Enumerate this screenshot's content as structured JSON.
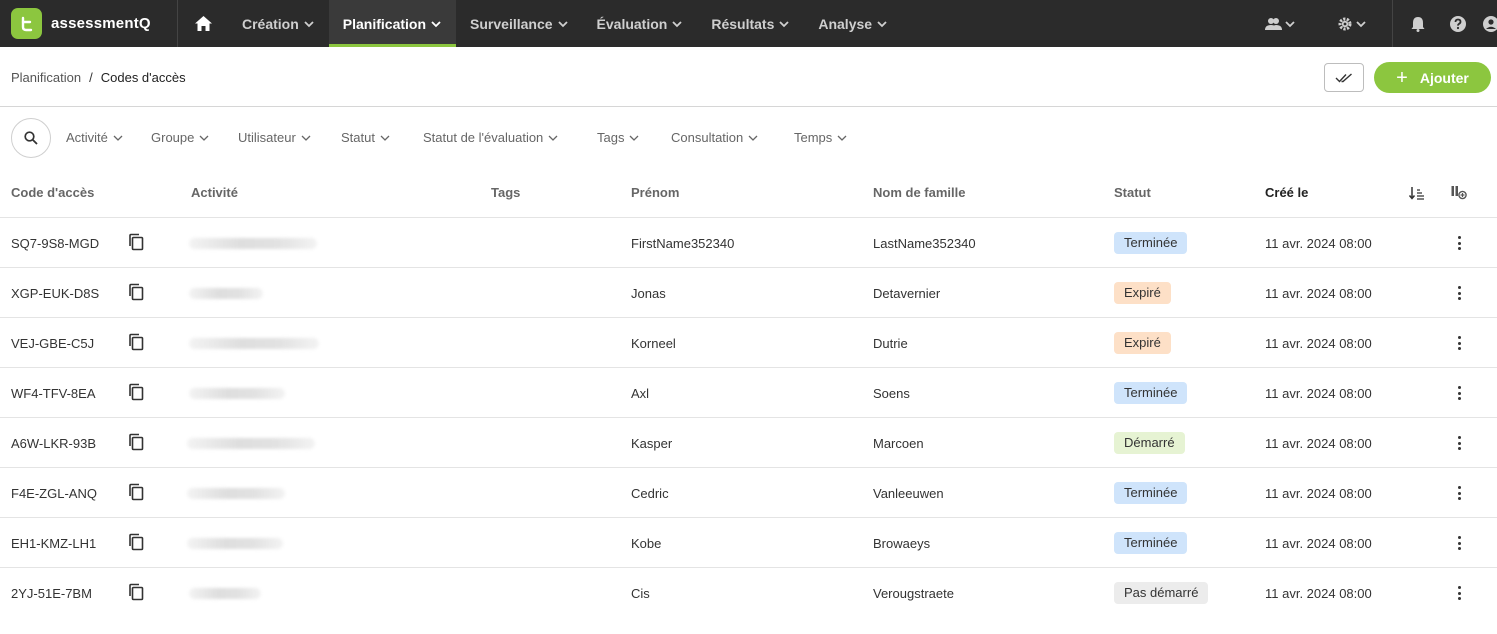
{
  "app": {
    "name": "assessmentQ",
    "logo_letter": "t"
  },
  "nav": {
    "items": [
      {
        "label": "Création",
        "active": false
      },
      {
        "label": "Planification",
        "active": true
      },
      {
        "label": "Surveillance",
        "active": false
      },
      {
        "label": "Évaluation",
        "active": false
      },
      {
        "label": "Résultats",
        "active": false
      },
      {
        "label": "Analyse",
        "active": false
      }
    ]
  },
  "breadcrumb": {
    "parent": "Planification",
    "separator": "/",
    "current": "Codes d'accès"
  },
  "actions": {
    "add_label": "Ajouter",
    "add_icon": "plus-icon",
    "check_icon": "double-check-icon"
  },
  "filters": [
    "Activité",
    "Groupe",
    "Utilisateur",
    "Statut",
    "Statut de l'évaluation",
    "Tags",
    "Consultation",
    "Temps"
  ],
  "table": {
    "headers": {
      "code": "Code d'accès",
      "activity": "Activité",
      "tags": "Tags",
      "firstname": "Prénom",
      "lastname": "Nom de famille",
      "status": "Statut",
      "created": "Créé le"
    },
    "rows": [
      {
        "code": "SQ7-9S8-MGD",
        "firstname": "FirstName352340",
        "lastname": "LastName352340",
        "status": "Terminée",
        "created": "11 avr. 2024 08:00"
      },
      {
        "code": "XGP-EUK-D8S",
        "firstname": "Jonas",
        "lastname": "Detavernier",
        "status": "Expiré",
        "created": "11 avr. 2024 08:00"
      },
      {
        "code": "VEJ-GBE-C5J",
        "firstname": "Korneel",
        "lastname": "Dutrie",
        "status": "Expiré",
        "created": "11 avr. 2024 08:00"
      },
      {
        "code": "WF4-TFV-8EA",
        "firstname": "Axl",
        "lastname": "Soens",
        "status": "Terminée",
        "created": "11 avr. 2024 08:00"
      },
      {
        "code": "A6W-LKR-93B",
        "firstname": "Kasper",
        "lastname": "Marcoen",
        "status": "Démarré",
        "created": "11 avr. 2024 08:00"
      },
      {
        "code": "F4E-ZGL-ANQ",
        "firstname": "Cedric",
        "lastname": "Vanleeuwen",
        "status": "Terminée",
        "created": "11 avr. 2024 08:00"
      },
      {
        "code": "EH1-KMZ-LH1",
        "firstname": "Kobe",
        "lastname": "Browaeys",
        "status": "Terminée",
        "created": "11 avr. 2024 08:00"
      },
      {
        "code": "2YJ-51E-7BM",
        "firstname": "Cis",
        "lastname": "Verougstraete",
        "status": "Pas démarré",
        "created": "11 avr. 2024 08:00"
      }
    ]
  },
  "colors": {
    "brand": "#8cc63f",
    "nav_bg": "#2b2b2b",
    "badge_terminee": "#cfe4fb",
    "badge_expire": "#fde0c7",
    "badge_demarre": "#e6f3d3",
    "badge_pas_demarre": "#ececec"
  }
}
